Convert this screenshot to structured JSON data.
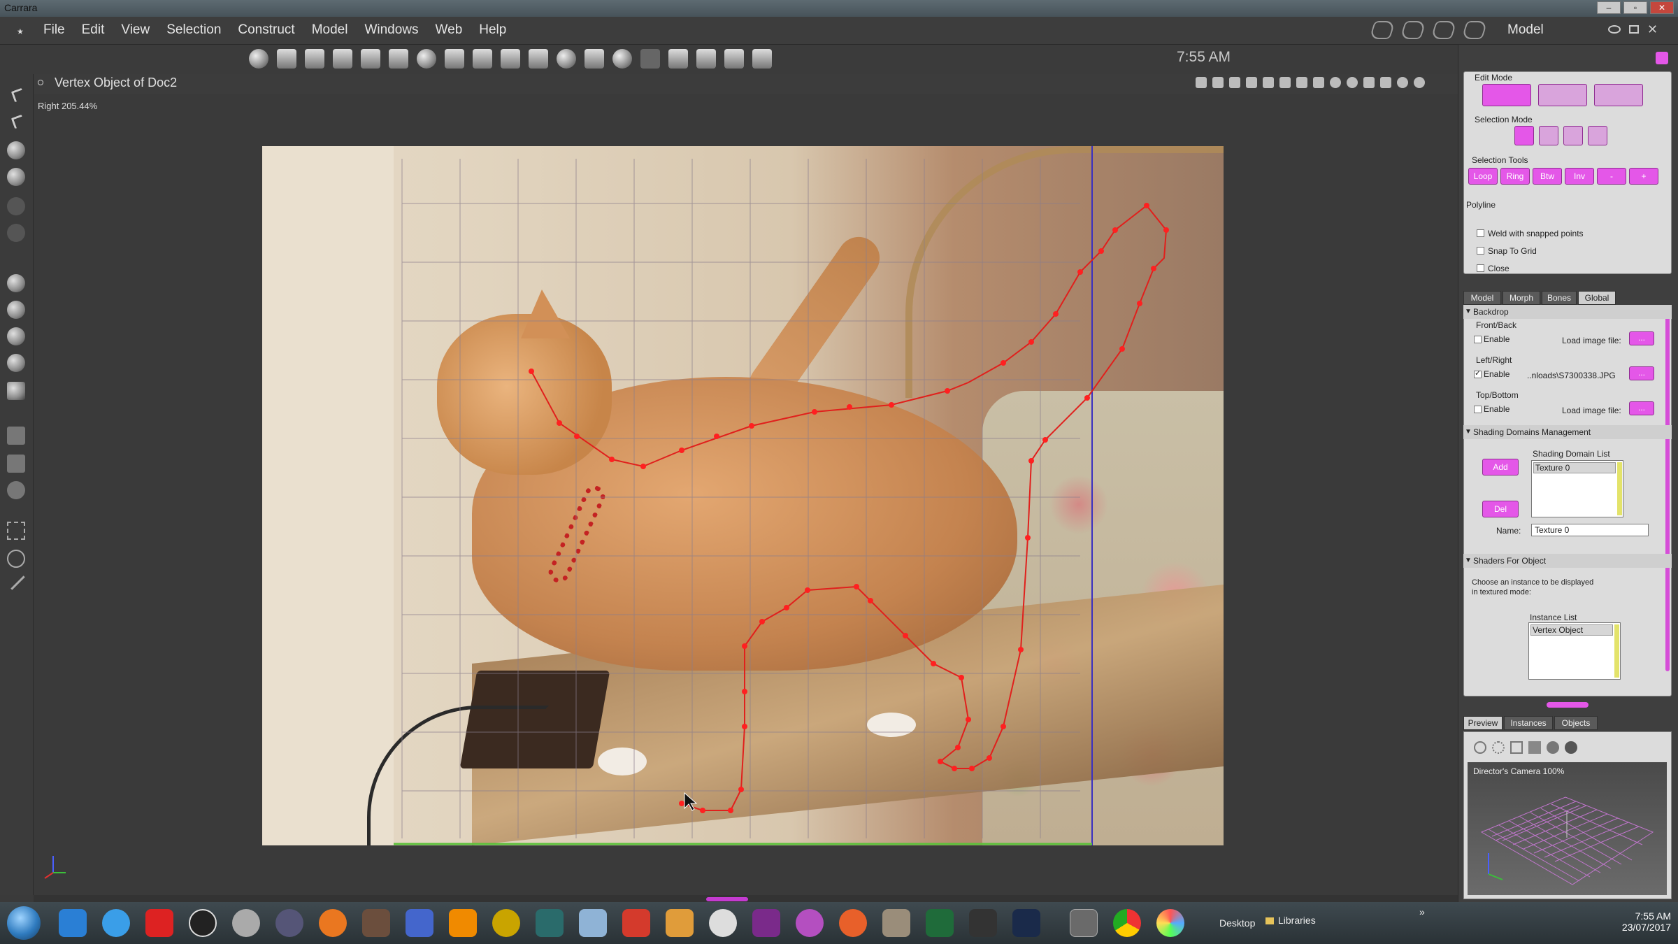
{
  "window": {
    "title": "Carrara",
    "min": "–",
    "max": "▫",
    "close": "✕"
  },
  "menu": {
    "logo": "⋆",
    "items": [
      "File",
      "Edit",
      "View",
      "Selection",
      "Construct",
      "Model",
      "Windows",
      "Web",
      "Help"
    ],
    "room_label": "Model"
  },
  "toolbar": {
    "clock": "7:55 AM"
  },
  "viewport": {
    "doc_title": "Vertex Object of Doc2",
    "view_label": "Right 205.44%"
  },
  "edit_mode": {
    "title": "Edit Mode",
    "selection_mode_title": "Selection Mode",
    "selection_tools_title": "Selection Tools",
    "selection_tools": [
      "Loop",
      "Ring",
      "Btw",
      "Inv",
      "-",
      "+"
    ],
    "polyline_title": "Polyline",
    "polyline_options": [
      {
        "label": "Weld with snapped points",
        "checked": false
      },
      {
        "label": "Snap To Grid",
        "checked": false
      },
      {
        "label": "Close",
        "checked": false
      }
    ]
  },
  "props_tabs": [
    "Model",
    "Morph",
    "Bones",
    "Global"
  ],
  "backdrop": {
    "section": "Backdrop",
    "front_back": {
      "title": "Front/Back",
      "enable": "Enable",
      "checked": false,
      "file_label": "Load image file:",
      "browse": "..."
    },
    "left_right": {
      "title": "Left/Right",
      "enable": "Enable",
      "checked": true,
      "file_value": "..nloads\\S7300338.JPG",
      "browse": "..."
    },
    "top_bottom": {
      "title": "Top/Bottom",
      "enable": "Enable",
      "checked": false,
      "file_label": "Load image file:",
      "browse": "..."
    }
  },
  "shading": {
    "section": "Shading Domains Management",
    "list_title": "Shading Domain List",
    "list_items": [
      "Texture 0"
    ],
    "add": "Add",
    "del": "Del",
    "name_label": "Name:",
    "name_value": "Texture 0"
  },
  "shaders": {
    "section": "Shaders For Object",
    "hint": "Choose an instance to be displayed in textured mode:",
    "list_title": "Instance List",
    "list_items": [
      "Vertex Object"
    ]
  },
  "bottom_tabs": [
    "Preview",
    "Instances",
    "Objects"
  ],
  "preview": {
    "camera_label": "Director's Camera 100%"
  },
  "taskbar": {
    "desktop": "Desktop",
    "libraries": "Libraries",
    "chevron": "»",
    "time": "7:55 AM",
    "date": "23/07/2017"
  }
}
